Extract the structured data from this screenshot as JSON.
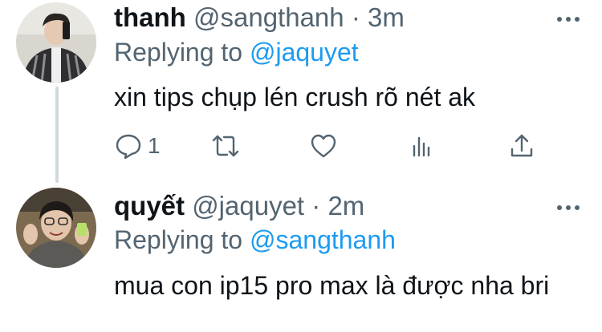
{
  "tweets": [
    {
      "display_name": "thanh",
      "handle": "@sangthanh",
      "time": "· 3m",
      "replying_prefix": "Replying to",
      "replying_to": "@jaquyet",
      "text": "xin tips chụp lén crush rõ nét ak",
      "actions": {
        "reply_icon": "reply-icon",
        "reply_count": "1",
        "retweet_icon": "retweet-icon",
        "like_icon": "heart-icon",
        "analytics_icon": "analytics-icon",
        "share_icon": "share-icon"
      },
      "more_icon": "more-icon"
    },
    {
      "display_name": "quyết",
      "handle": "@jaquyet",
      "time": "· 2m",
      "replying_prefix": "Replying to",
      "replying_to": "@sangthanh",
      "text": "mua con ip15 pro max là được nha bri",
      "more_icon": "more-icon"
    }
  ],
  "colors": {
    "link": "#1d9bf0",
    "secondary_text": "#536471",
    "thread_line": "#cfd9de"
  }
}
